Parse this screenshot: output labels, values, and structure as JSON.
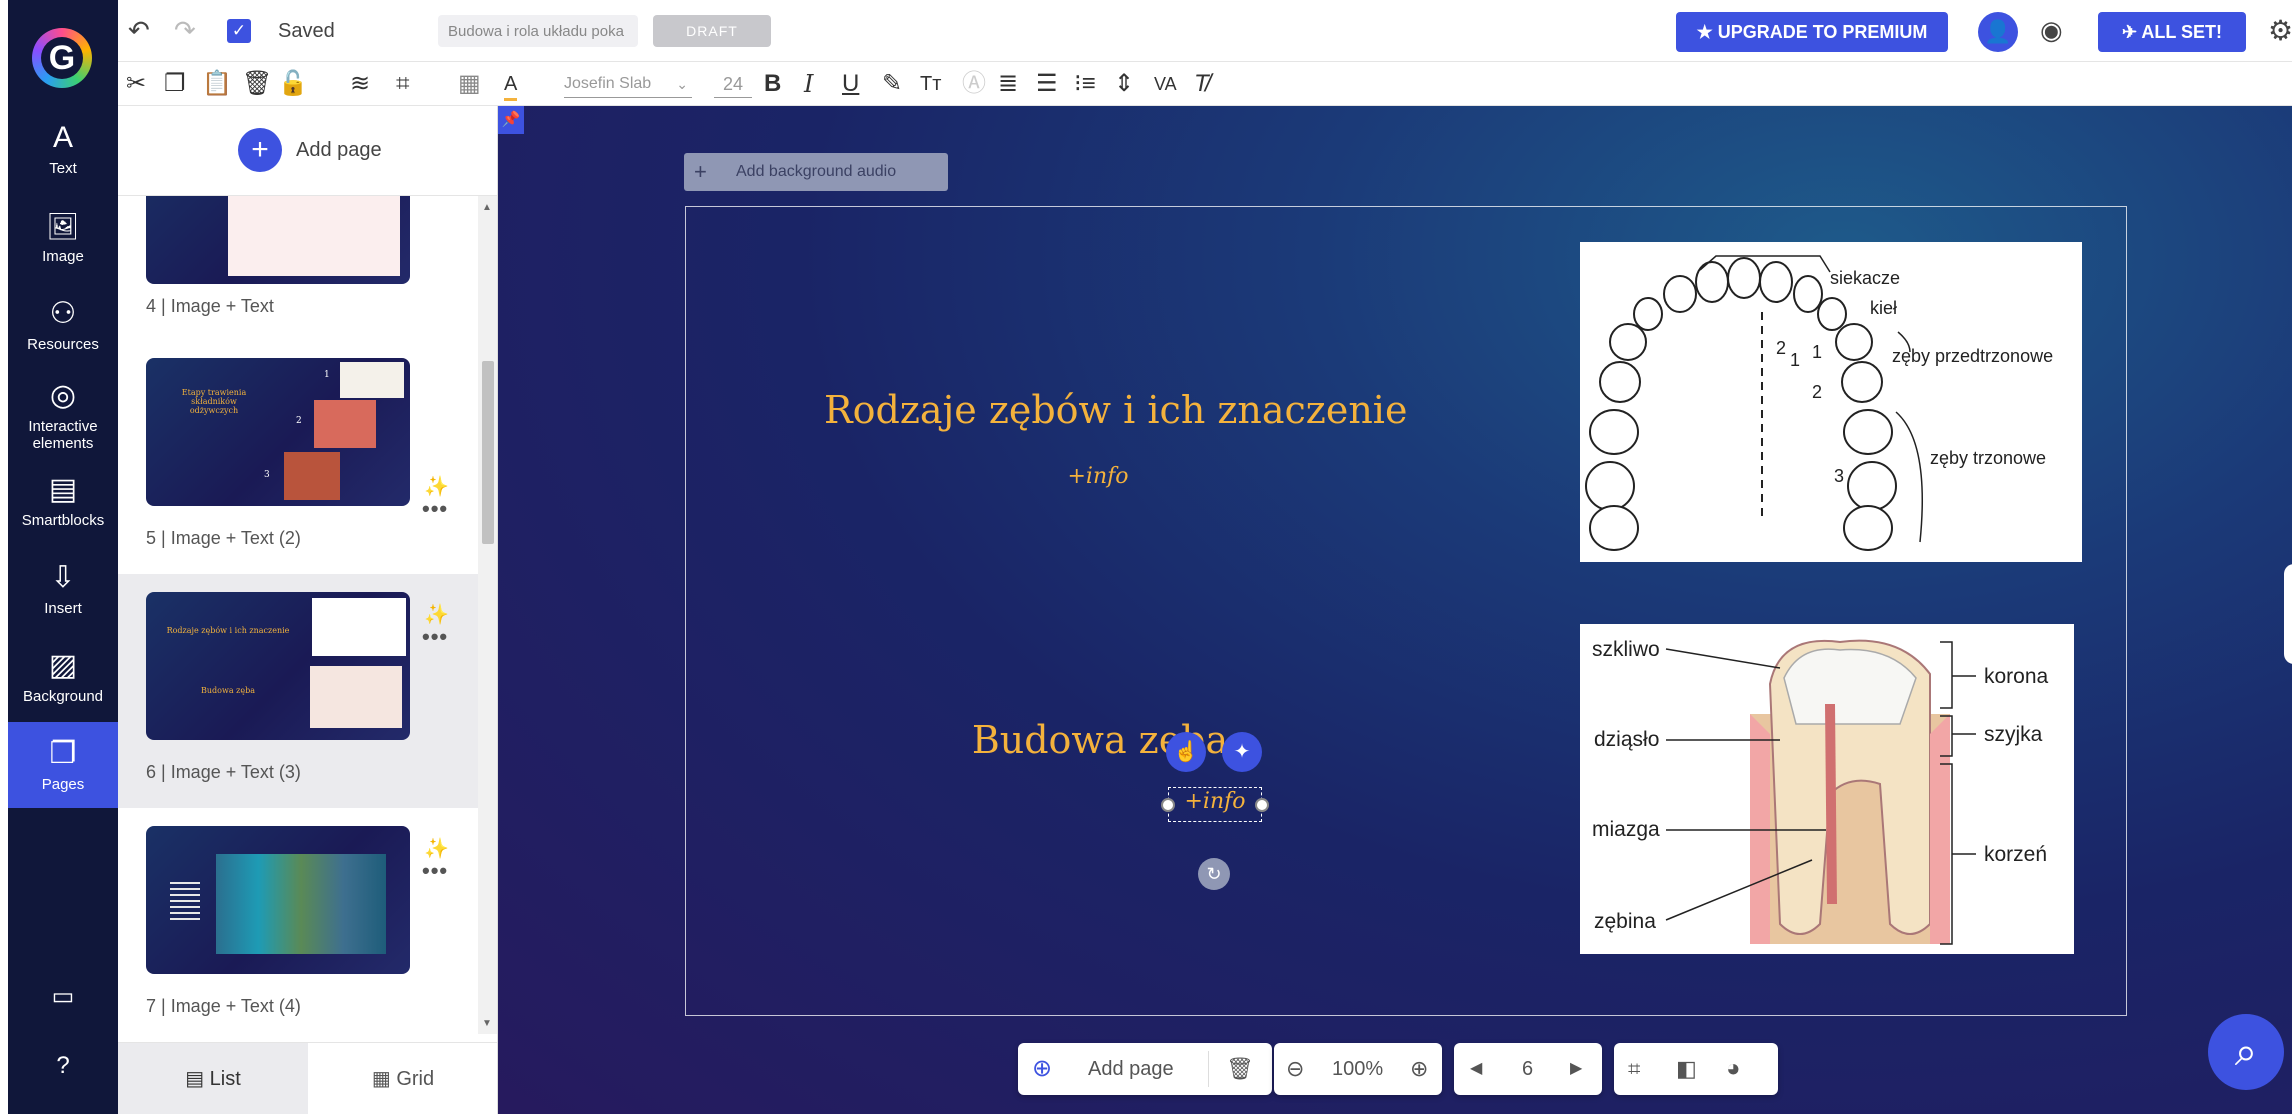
{
  "rail": {
    "logo": "genially-logo-icon",
    "items": [
      {
        "label": "Text",
        "icon": "A"
      },
      {
        "label": "Image",
        "icon": "🖼"
      },
      {
        "label": "Resources",
        "icon": "⚇"
      },
      {
        "label": "Interactive elements",
        "icon": "◎"
      },
      {
        "label": "Smartblocks",
        "icon": "▤"
      },
      {
        "label": "Insert",
        "icon": "⇩"
      },
      {
        "label": "Background",
        "icon": "▨"
      },
      {
        "label": "Pages",
        "icon": "❐"
      }
    ]
  },
  "topbar": {
    "saved_label": "Saved",
    "title_value": "Budowa i rola układu poka",
    "draft_label": "DRAFT",
    "upgrade_label": "UPGRADE TO PREMIUM",
    "allset_label": "ALL SET!"
  },
  "format": {
    "font_name": "Josefin Slab",
    "font_size": "24"
  },
  "panel": {
    "add_page_label": "Add page",
    "slides": [
      {
        "label": "4 | Image + Text"
      },
      {
        "label": "5 | Image + Text (2)",
        "thumb_title": "Etapy trawienia składników odżywczych",
        "nums": [
          "1",
          "2",
          "3"
        ]
      },
      {
        "label": "6 | Image + Text (3)",
        "thumb_title_1": "Rodzaje zębów i ich znaczenie",
        "thumb_title_2": "Budowa zęba"
      },
      {
        "label": "7 | Image + Text (4)"
      }
    ],
    "view_list_label": "List",
    "view_grid_label": "Grid"
  },
  "canvas": {
    "add_audio_label": "Add background audio",
    "heading_1": "Rodzaje zębów i ich znaczenie",
    "info_1": "+info",
    "heading_2": "Budowa zęba",
    "info_2": "+info",
    "teeth_labels": [
      "siekacze",
      "kieł",
      "zęby przedtrzonowe",
      "zęby trzonowe",
      "1",
      "2",
      "1",
      "2",
      "3"
    ],
    "tooth_labels_left": [
      "szkliwo",
      "dziąsło",
      "miazga",
      "zębina"
    ],
    "tooth_labels_right": [
      "korona",
      "szyjka",
      "korzeń"
    ]
  },
  "bottom": {
    "add_page_label": "Add page",
    "zoom": "100%",
    "page_number": "6"
  },
  "colors": {
    "accent": "#3d52e0",
    "rail_bg": "#10173a",
    "heading_gold": "#f4b23c"
  }
}
